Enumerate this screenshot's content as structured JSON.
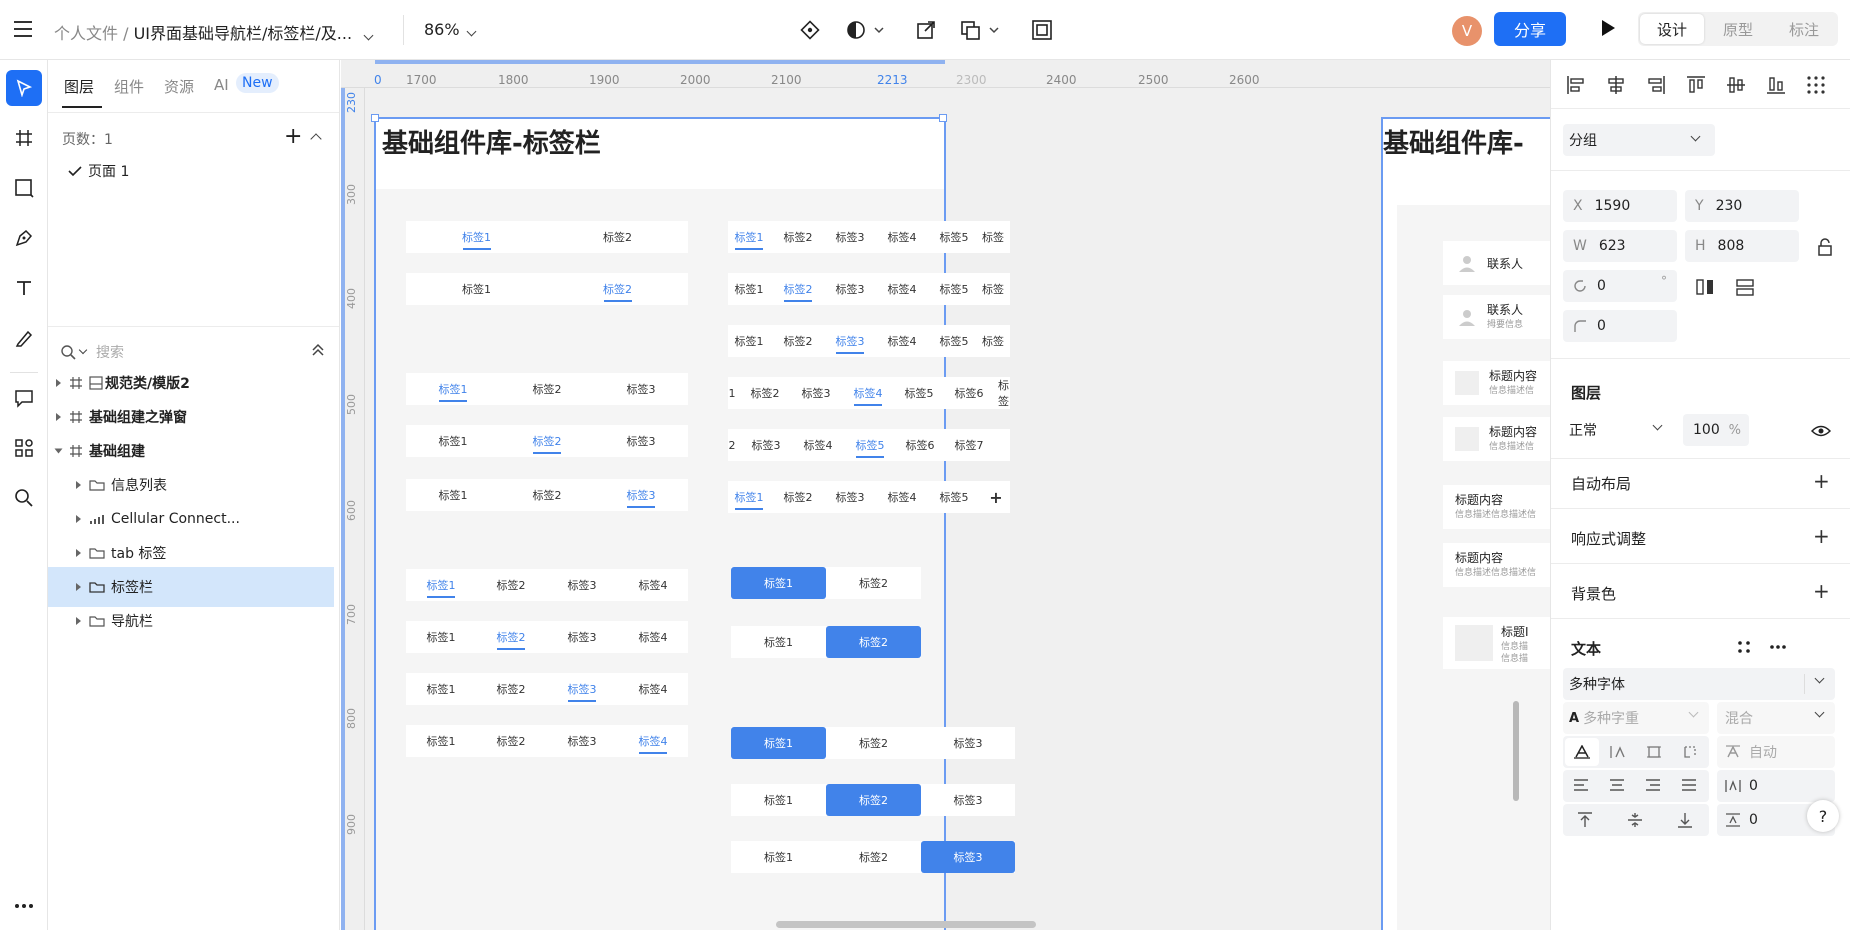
{
  "topbar": {
    "breadcrumb_root": "个人文件",
    "breadcrumb_sep": "/",
    "breadcrumb_file": "UI界面基础导航栏/标签栏/及...",
    "zoom": "86%",
    "avatar_letter": "V",
    "share_label": "分享",
    "mode_tabs": [
      "设计",
      "原型",
      "标注"
    ]
  },
  "left_panel": {
    "tabs": [
      "图层",
      "组件",
      "资源",
      "AI"
    ],
    "ai_badge": "New",
    "pages_label": "页数：1",
    "page_item": "页面 1",
    "search_placeholder": "搜索",
    "layers": [
      {
        "label": "规范类/模版2",
        "bold": true
      },
      {
        "label": "基础组建之弹窗",
        "bold": true
      },
      {
        "label": "基础组建",
        "bold": true
      },
      {
        "label": "信息列表",
        "bold": false
      },
      {
        "label": "Cellular Connect...",
        "bold": false
      },
      {
        "label": "tab 标签",
        "bold": false
      },
      {
        "label": "标签栏",
        "bold": false
      },
      {
        "label": "导航栏",
        "bold": false
      }
    ]
  },
  "canvas": {
    "ruler_top": [
      "1700",
      "1800",
      "1900",
      "2000",
      "2100",
      "2213",
      "2300",
      "2400",
      "2500",
      "2600"
    ],
    "ruler_top_start": "0",
    "ruler_left": [
      "230",
      "300",
      "400",
      "500",
      "600",
      "700",
      "800",
      "900"
    ],
    "frame_title": "基础组件库-标签栏",
    "frame2_title": "基础组件库-",
    "tabs": {
      "t1": "标签1",
      "t2": "标签2",
      "t3": "标签3",
      "t4": "标签4",
      "t5": "标签5",
      "t6": "标签6",
      "t7": "标签7",
      "t_cut": "标签",
      "num1": "1",
      "num2": "2",
      "plus": "+"
    },
    "right_frame": {
      "contact": "联系人",
      "contact_sub": "拇要信息",
      "title_content": "标题内容",
      "title_cut": "标题内容",
      "desc": "信息描述信息描述信",
      "desc_cut": "信息描述信",
      "title_small": "标题I",
      "desc_small": "信息描",
      "desc_small2": "信息描"
    }
  },
  "right_panel": {
    "group_select": "分组",
    "x_label": "X",
    "x_value": "1590",
    "y_label": "Y",
    "y_value": "230",
    "w_label": "W",
    "w_value": "623",
    "h_label": "H",
    "h_value": "808",
    "rotation": "0",
    "degree": "°",
    "radius": "0",
    "layer_title": "图层",
    "blend": "正常",
    "opacity": "100",
    "opacity_unit": "%",
    "auto_layout": "自动布局",
    "responsive": "响应式调整",
    "bg_color": "背景色",
    "text_title": "文本",
    "font_family": "多种字体",
    "font_weight": "多种字重",
    "font_size": "混合",
    "auto_label": "自动",
    "letter_spacing": "0",
    "line_height": "0",
    "help": "?"
  },
  "colors": {
    "accent": "#1e6ff5",
    "tab_active": "#4183ea",
    "avatar": "#e8926b"
  }
}
